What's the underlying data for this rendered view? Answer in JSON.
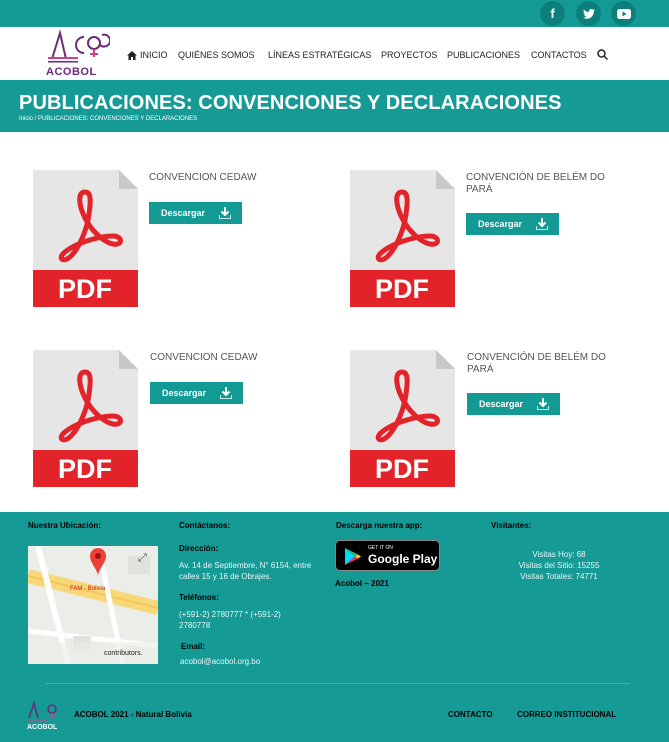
{
  "social": {
    "facebook": "f",
    "twitter": "t",
    "youtube": "yt"
  },
  "brand": {
    "logo_text": "ACOBOL"
  },
  "nav": {
    "home": "INICIO",
    "items": [
      "QUIÉNES SOMOS",
      "LÍNEAS ESTRATÉGICAS",
      "PROYECTOS",
      "PUBLICACIONES",
      "CONTACTOS"
    ]
  },
  "page": {
    "title": "PUBLICACIONES: CONVENCIONES Y DECLARACIONES",
    "breadcrumb": "Inicio / PUBLICACIONES: CONVENCIONES Y DECLARACIONES"
  },
  "publications": [
    {
      "title": "CONVENCION CEDAW",
      "button": "Descargar",
      "pdf_label": "PDF"
    },
    {
      "title": "CONVENCIÓN DE BELÉM DO PARÁ",
      "button": "Descargar",
      "pdf_label": "PDF"
    },
    {
      "title": "CONVENCION CEDAW",
      "button": "Descargar",
      "pdf_label": "PDF"
    },
    {
      "title": "CONVENCIÓN DE BELÉM DO PARÁ",
      "button": "Descargar",
      "pdf_label": "PDF"
    }
  ],
  "footer": {
    "location_heading": "Nuestra Ubicación:",
    "map_label": "FAM - Bolivia",
    "map_credit": "contributors.",
    "contact_heading": "Contáctanos:",
    "address_label": "Dirección:",
    "address": "Av. 14 de Septiembre, N° 6154, entre calles 15 y 16 de Obrajes.",
    "phones_label": "Teléfonos:",
    "phones": "(+591-2) 2780777 * (+591-2) 2780778",
    "email_label": "Email:",
    "email": "acobol@acobol.org.bo",
    "app_heading": "Descarga nuestra app:",
    "gplay_small": "GET IT ON",
    "gplay_big": "Google Play",
    "copyright_app": "Acobol – 2021",
    "visitors_heading": "Visitantes:",
    "visits_today": "Visitas Hoy: 68",
    "visits_site": "Visitas del Sitio: 15255",
    "visits_total": "Visitas Totales: 74771",
    "bottom_text": "ACOBOL 2021 - Natural Bolivia",
    "link_contact": "CONTACTO",
    "link_mail": "CORREO INSTITUCIONAL"
  },
  "colors": {
    "primary": "#139a95",
    "pdf_red": "#e2232a",
    "brand_purple": "#6a2b7a"
  }
}
